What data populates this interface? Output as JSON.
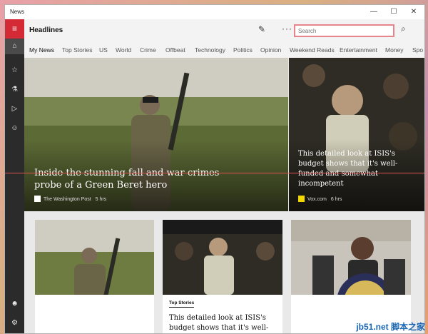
{
  "window": {
    "title": "News"
  },
  "header": {
    "title": "Headlines",
    "search_placeholder": "Search"
  },
  "tabs": [
    {
      "label": "My News",
      "active": true
    },
    {
      "label": "Top Stories"
    },
    {
      "label": "US"
    },
    {
      "label": "World"
    },
    {
      "label": "Crime"
    },
    {
      "label": "Offbeat"
    },
    {
      "label": "Technology"
    },
    {
      "label": "Politics"
    },
    {
      "label": "Opinion"
    },
    {
      "label": "Weekend Reads"
    },
    {
      "label": "Entertainment"
    },
    {
      "label": "Money"
    },
    {
      "label": "Spo"
    }
  ],
  "sidebar": {
    "items": [
      {
        "icon": "home-icon"
      },
      {
        "icon": "star-icon"
      },
      {
        "icon": "flask-icon"
      },
      {
        "icon": "play-icon"
      },
      {
        "icon": "smiley-icon"
      }
    ],
    "bottom": [
      {
        "icon": "account-icon"
      },
      {
        "icon": "settings-icon"
      }
    ]
  },
  "hero": {
    "headline": "Inside the stunning fall and war-crimes probe of a Green Beret hero",
    "source": "The Washington Post",
    "time": "5 hrs"
  },
  "hero2": {
    "headline": "This detailed look at ISIS's budget shows that it's well-funded and somewhat incompetent",
    "source": "Vox.com",
    "time": "6 hrs"
  },
  "cards": [
    {
      "category": "",
      "headline": ""
    },
    {
      "category": "Top Stories",
      "headline": "This detailed look at ISIS's budget shows that it's well-"
    },
    {
      "category": "",
      "headline": ""
    }
  ],
  "watermark": "jb51.net 脚本之家",
  "colors": {
    "accent": "#d42a36",
    "sidebar": "#2b2b2b",
    "search_border": "#e6858c"
  }
}
